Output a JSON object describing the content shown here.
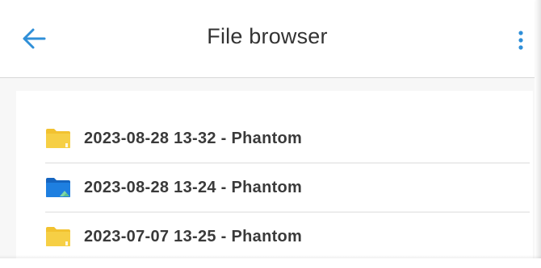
{
  "header": {
    "title": "File browser",
    "back_icon": "arrow-left-icon",
    "menu_icon": "more-vertical-icon"
  },
  "colors": {
    "accent": "#2f8fd8",
    "folder_yellow": "#f2c230",
    "folder_blue": "#1e7fe0"
  },
  "files": [
    {
      "name": "2023-08-28 13-32 - Phantom",
      "icon": "folder-icon",
      "variant": "yellow"
    },
    {
      "name": "2023-08-28 13-24 - Phantom",
      "icon": "image-folder-icon",
      "variant": "blue"
    },
    {
      "name": "2023-07-07 13-25 - Phantom",
      "icon": "folder-icon",
      "variant": "yellow"
    }
  ]
}
